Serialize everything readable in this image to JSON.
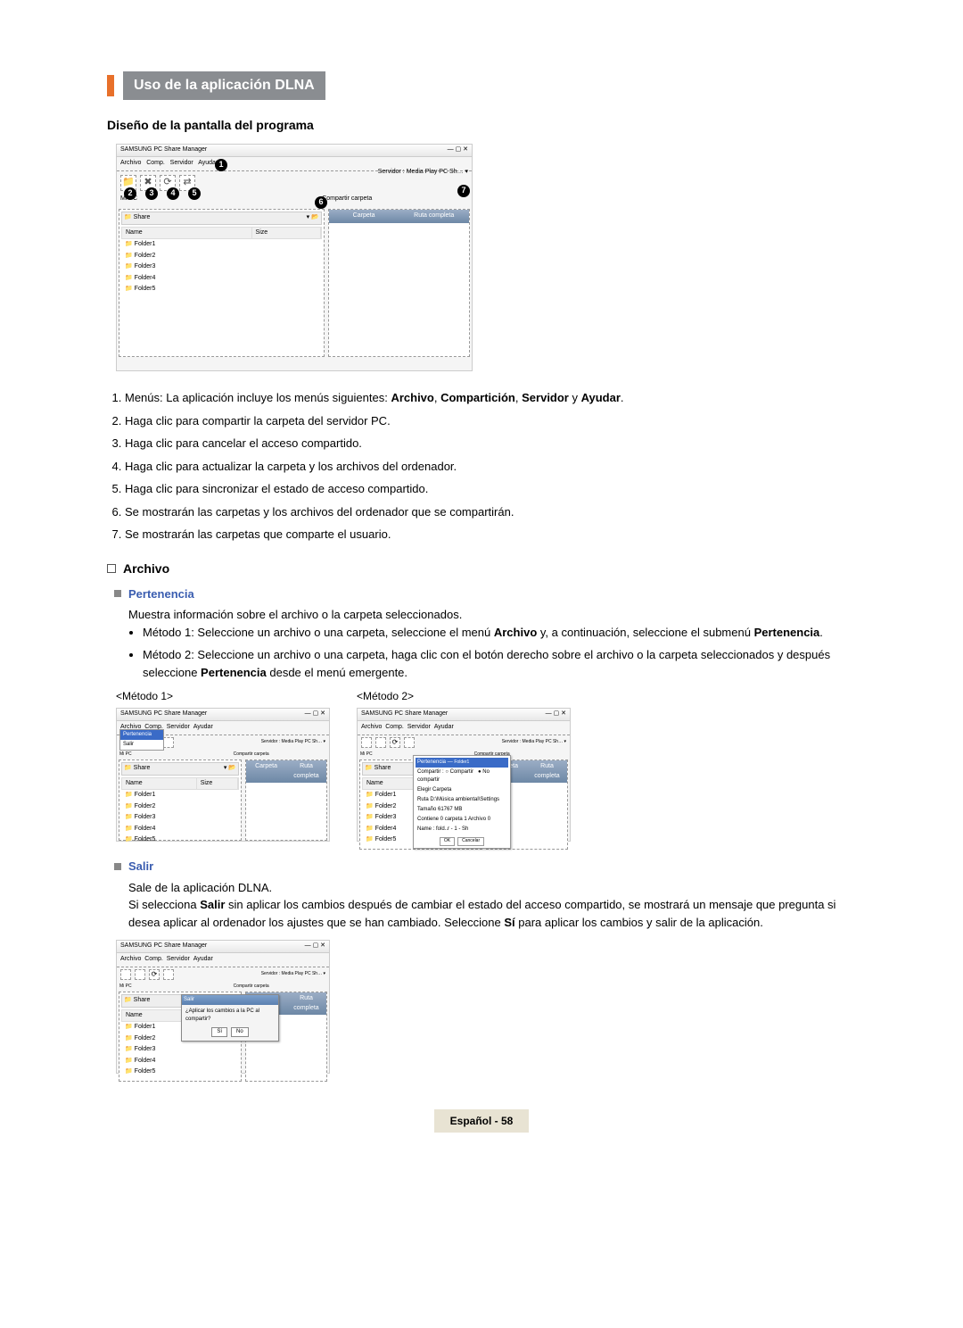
{
  "section_title": "Uso de la aplicación DLNA",
  "layout_title": "Diseño de la pantalla del programa",
  "app": {
    "window_title": "SAMSUNG PC Share Manager",
    "menus": [
      "Archivo",
      "Comp.",
      "Servidor",
      "Ayudar"
    ],
    "server_label": "Servidor :",
    "server_value": "Media Play PC Sh…",
    "mypc_label": "Mi PC",
    "shared_label": "Compartir carpeta",
    "share_path": "Share",
    "cols_left": [
      "Name",
      "Size"
    ],
    "cols_right": [
      "Carpeta",
      "Ruta completa"
    ],
    "folders": [
      "Folder1",
      "Folder2",
      "Folder3",
      "Folder4",
      "Folder5"
    ]
  },
  "callouts": [
    "1",
    "2",
    "3",
    "4",
    "5",
    "6",
    "7"
  ],
  "numbered": [
    "Menús: La aplicación incluye los menús siguientes: Archivo, Compartición, Servidor y Ayudar.",
    "Haga clic para compartir la carpeta del servidor PC.",
    "Haga clic para cancelar el acceso compartido.",
    "Haga clic para actualizar la carpeta y los archivos del ordenador.",
    "Haga clic para sincronizar el estado de acceso compartido.",
    "Se mostrarán las carpetas y los archivos del ordenador que se compartirán.",
    "Se mostrarán las carpetas que comparte el usuario."
  ],
  "archivo_heading": "Archivo",
  "pertenencia_heading": "Pertenencia",
  "pertenencia_desc": "Muestra información sobre el archivo o la carpeta seleccionados.",
  "pertenencia_m1a": "Método 1: Seleccione un archivo o una carpeta, seleccione el menú ",
  "pertenencia_m1b": "Archivo",
  "pertenencia_m1c": " y, a continuación, seleccione el submenú ",
  "pertenencia_m1d": "Pertenencia",
  "pertenencia_m1e": ".",
  "pertenencia_m2a": "Método 2: Seleccione un archivo o una carpeta, haga clic con el botón derecho sobre el archivo o la carpeta seleccionados y después seleccione ",
  "pertenencia_m2b": "Pertenencia",
  "pertenencia_m2c": " desde el menú emergente.",
  "method1_label": "<Método 1>",
  "method2_label": "<Método 2>",
  "menu_dropdown": {
    "hl": "Pertenencia",
    "other": "Salir"
  },
  "ctx": {
    "hl": "Pertenencia",
    "radio1": "Compartir",
    "radio2": "No compartir",
    "rows": [
      "   Elegir Carpeta",
      "   Ruta      D:\\Música ambiental\\Settings",
      "   Tamaño   61767 MB",
      "   Contiene 0 carpeta 1 Archivo 0",
      "   Name : fold..r - 1 - Sh"
    ],
    "ok": "OK",
    "cancel": "Cancelar"
  },
  "salir_heading": "Salir",
  "salir_desc": "Sale de la aplicación DLNA.",
  "salir_p1a": "Si selecciona ",
  "salir_p1b": "Salir",
  "salir_p1c": " sin aplicar los cambios después de cambiar el estado del acceso compartido, se mostrará un mensaje que pregunta si desea aplicar al ordenador los ajustes que se han cambiado. Seleccione ",
  "salir_p1d": "Sí",
  "salir_p1e": " para aplicar los cambios y salir de la aplicación.",
  "dialog": {
    "title": "Salir",
    "msg": "¿Aplicar los cambios a la PC al compartir?",
    "yes": "Sí",
    "no": "No"
  },
  "footer_lang": "Español - ",
  "footer_page": "58"
}
